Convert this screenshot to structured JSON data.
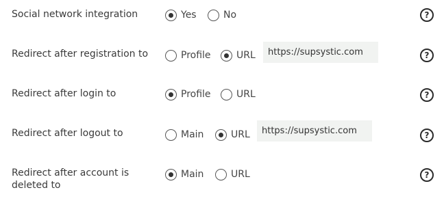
{
  "rows": [
    {
      "label": "Social network integration",
      "options": [
        {
          "label": "Yes",
          "checked": true
        },
        {
          "label": "No",
          "checked": false
        }
      ]
    },
    {
      "label": "Redirect after registration to",
      "options": [
        {
          "label": "Profile",
          "checked": false
        },
        {
          "label": "URL",
          "checked": true
        }
      ],
      "url_value": "https://supsystic.com"
    },
    {
      "label": "Redirect after login to",
      "options": [
        {
          "label": "Profile",
          "checked": true
        },
        {
          "label": "URL",
          "checked": false
        }
      ]
    },
    {
      "label": "Redirect after logout to",
      "options": [
        {
          "label": "Main",
          "checked": false
        },
        {
          "label": "URL",
          "checked": true
        }
      ],
      "url_value": "https://supsystic.com"
    },
    {
      "label": "Redirect after account is deleted to",
      "options": [
        {
          "label": "Main",
          "checked": true
        },
        {
          "label": "URL",
          "checked": false
        }
      ]
    }
  ],
  "help_icon_glyph": "?",
  "colors": {
    "input_bg": "#f1f3f1",
    "text": "#444444",
    "radio_dot": "#333333"
  }
}
